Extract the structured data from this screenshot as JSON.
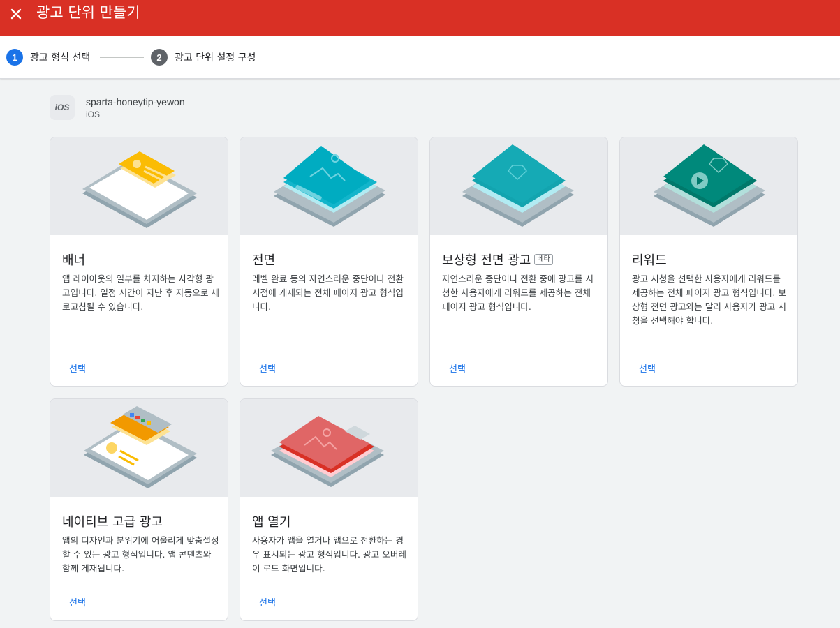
{
  "header": {
    "title": "광고 단위 만들기",
    "close_icon": "close-icon"
  },
  "stepper": {
    "steps": [
      {
        "number": "1",
        "label": "광고 형식 선택"
      },
      {
        "number": "2",
        "label": "광고 단위 설정 구성"
      }
    ]
  },
  "app": {
    "icon_text": "iOS",
    "name": "sparta-honeytip-yewon",
    "platform": "iOS"
  },
  "cards": [
    {
      "title": "배너",
      "description": "앱 레이아웃의 일부를 차지하는 사각형 광고입니다. 일정 시간이 지난 후 자동으로 새로고침될 수 있습니다.",
      "select_label": "선택",
      "color": "#fbbc04"
    },
    {
      "title": "전면",
      "description": "레벨 완료 등의 자연스러운 중단이나 전환 시점에 게재되는 전체 페이지 광고 형식입니다.",
      "select_label": "선택",
      "color": "#12b5cb"
    },
    {
      "title": "보상형 전면 광고",
      "badge": "베타",
      "description": "자연스러운 중단이나 전환 중에 광고를 시청한 사용자에게 리워드를 제공하는 전체 페이지 광고 형식입니다.",
      "select_label": "선택",
      "color": "#12a4af"
    },
    {
      "title": "리워드",
      "description": "광고 시청을 선택한 사용자에게 리워드를 제공하는 전체 페이지 광고 형식입니다. 보상형 전면 광고와는 달리 사용자가 광고 시청을 선택해야 합니다.",
      "select_label": "선택",
      "color": "#00897b"
    },
    {
      "title": "네이티브 고급 광고",
      "description": "앱의 디자인과 분위기에 어울리게 맞춤설정할 수 있는 광고 형식입니다. 앱 콘텐츠와 함께 게재됩니다.",
      "select_label": "선택",
      "color": "#f29900"
    },
    {
      "title": "앱 열기",
      "description": "사용자가 앱을 열거나 앱으로 전환하는 경우 표시되는 광고 형식입니다. 광고 오버레이 로드 화면입니다.",
      "select_label": "선택",
      "color": "#e06666"
    }
  ],
  "colors": {
    "header": "#d93025",
    "accent": "#1a73e8"
  }
}
